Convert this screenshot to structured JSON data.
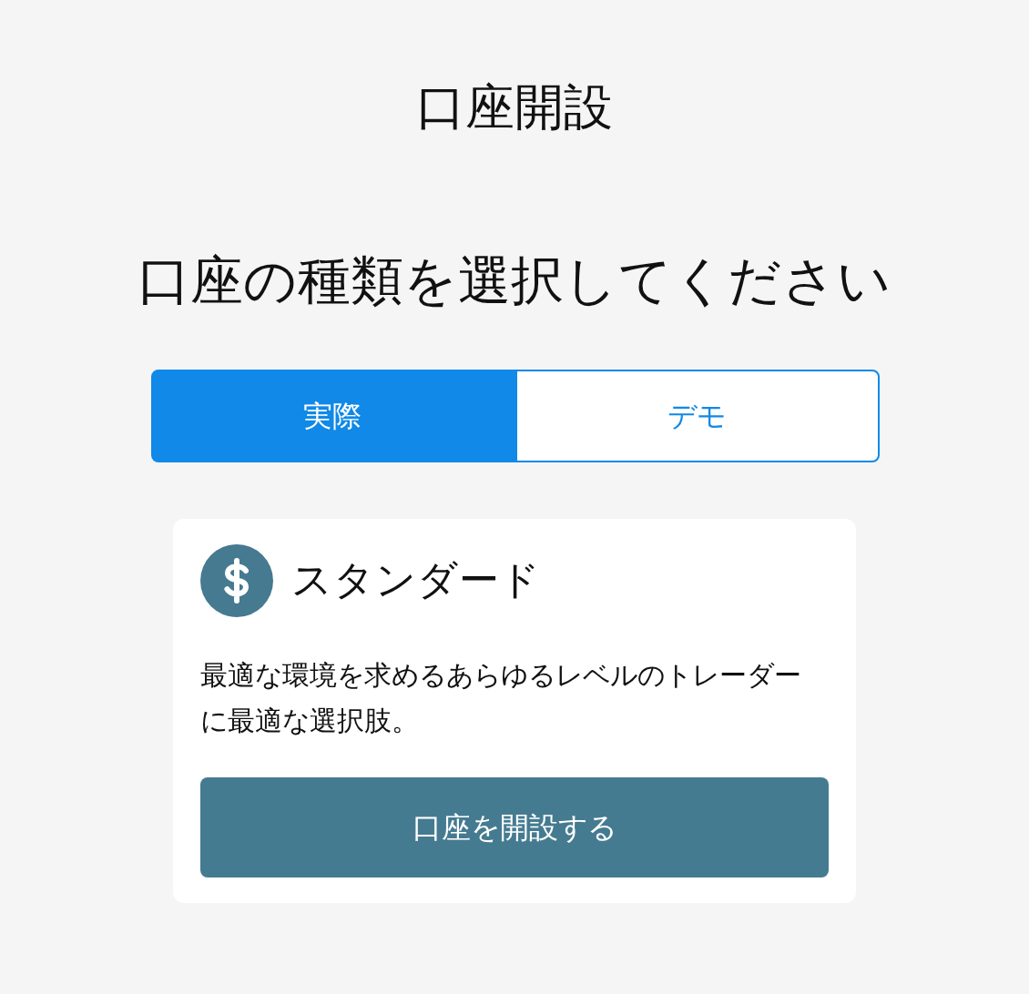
{
  "page_title": "口座開設",
  "heading": "口座の種類を選択してください",
  "tabs": [
    {
      "label": "実際",
      "selected": true
    },
    {
      "label": "デモ",
      "selected": false
    }
  ],
  "card": {
    "title": "スタンダード",
    "description": "最適な環境を求めるあらゆるレベルのトレーダーに最適な選択肢。",
    "button": "口座を開設する"
  }
}
